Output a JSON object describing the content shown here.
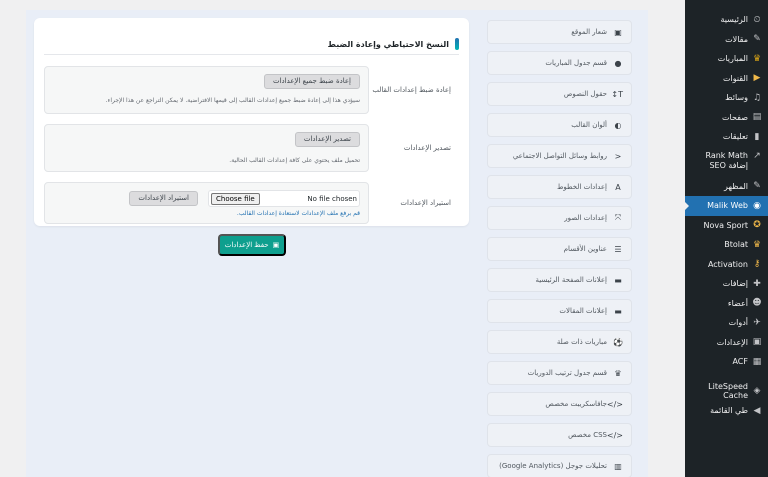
{
  "sidebar": {
    "items": [
      {
        "label": "الرئيسية",
        "icon": "dashboard-icon",
        "glyph": "⏲"
      },
      {
        "label": "مقالات",
        "icon": "pin-icon",
        "glyph": "✎"
      },
      {
        "label": "المباريات",
        "icon": "trophy-icon",
        "glyph": "♛"
      },
      {
        "label": "القنوات",
        "icon": "play-icon",
        "glyph": "▶"
      },
      {
        "label": "وسائط",
        "icon": "media-icon",
        "glyph": "♫"
      },
      {
        "label": "صفحات",
        "icon": "pages-icon",
        "glyph": "▤"
      },
      {
        "label": "تعليقات",
        "icon": "comments-icon",
        "glyph": "▮"
      },
      {
        "label": "Rank Math إضافة SEO",
        "icon": "rank-math-icon",
        "glyph": "↗"
      },
      {
        "label": "المظهر",
        "icon": "appearance-icon",
        "glyph": "✎"
      },
      {
        "label": "Malik Web",
        "icon": "malik-web-icon",
        "glyph": "◉"
      },
      {
        "label": "Nova Sport",
        "icon": "nova-sport-icon",
        "glyph": "✪"
      },
      {
        "label": "Btolat",
        "icon": "btolat-icon",
        "glyph": "♛"
      },
      {
        "label": "Activation",
        "icon": "key-icon",
        "glyph": "⚷"
      },
      {
        "label": "إضافات",
        "icon": "plugins-icon",
        "glyph": "✚"
      },
      {
        "label": "أعضاء",
        "icon": "users-icon",
        "glyph": "☻"
      },
      {
        "label": "أدوات",
        "icon": "tools-icon",
        "glyph": "✈"
      },
      {
        "label": "الإعدادات",
        "icon": "settings-icon",
        "glyph": "▣"
      },
      {
        "label": "ACF",
        "icon": "acf-icon",
        "glyph": "▦"
      },
      {
        "label": "LiteSpeed Cache",
        "icon": "litespeed-icon",
        "glyph": "◈"
      },
      {
        "label": "طي القائمة",
        "icon": "collapse-icon",
        "glyph": "◀"
      }
    ]
  },
  "tabs": [
    {
      "label": "شعار الموقع",
      "icon": "image-icon",
      "glyph": "▣"
    },
    {
      "label": "قسم جدول المباريات",
      "icon": "clock-icon",
      "glyph": "●"
    },
    {
      "label": "حقول النصوص",
      "icon": "text-icon",
      "glyph": "T↕"
    },
    {
      "label": "ألوان القالب",
      "icon": "palette-icon",
      "glyph": "◐"
    },
    {
      "label": "روابط وسائل التواصل الاجتماعي",
      "icon": "share-icon",
      "glyph": "<"
    },
    {
      "label": "إعدادات الخطوط",
      "icon": "font-icon",
      "glyph": "A"
    },
    {
      "label": "إعدادات الصور",
      "icon": "expand-icon",
      "glyph": "⤧"
    },
    {
      "label": "عناوين الأقسام",
      "icon": "list-icon",
      "glyph": "☰"
    },
    {
      "label": "إعلانات الصفحة الرئيسية",
      "icon": "ad-icon",
      "glyph": "▬"
    },
    {
      "label": "إعلانات المقالات",
      "icon": "ad-icon",
      "glyph": "▬"
    },
    {
      "label": "مباريات ذات صلة",
      "icon": "football-icon",
      "glyph": "⚽"
    },
    {
      "label": "قسم جدول ترتيب الدوريات",
      "icon": "trophy-icon",
      "glyph": "♛"
    },
    {
      "label": "جافاسكريبت مخصص",
      "icon": "code-icon",
      "glyph": "</>"
    },
    {
      "label": "CSS مخصص",
      "icon": "code-icon",
      "glyph": "</>"
    },
    {
      "label": "تحليلات جوجل (Google Analytics)",
      "icon": "chart-icon",
      "glyph": "▥"
    }
  ],
  "panel": {
    "title": "النسخ الاحتياطي وإعادة الضبط",
    "reset": {
      "label": "إعادة ضبط إعدادات القالب",
      "button": "إعادة ضبط جميع الإعدادات",
      "desc": "سيؤدي هذا إلى إعادة ضبط جميع إعدادات القالب إلى قيمها الافتراضية. لا يمكن التراجع عن هذا الإجراء."
    },
    "export": {
      "label": "تصدير الإعدادات",
      "button": "تصدير الإعدادات",
      "desc": "تحميل ملف يحتوي على كافة إعدادات القالب الحالية."
    },
    "import": {
      "label": "استيراد الإعدادات",
      "choose": "Choose file",
      "status": "No file chosen",
      "button": "استيراد الإعدادات",
      "desc": "قم برفع ملف الإعدادات لاستعادة إعدادات القالب."
    }
  },
  "save_button": "حفظ الإعدادات",
  "colors": {
    "accent": "#0e9f8e",
    "wp_blue": "#2271b1",
    "sidebar": "#1d2327"
  }
}
